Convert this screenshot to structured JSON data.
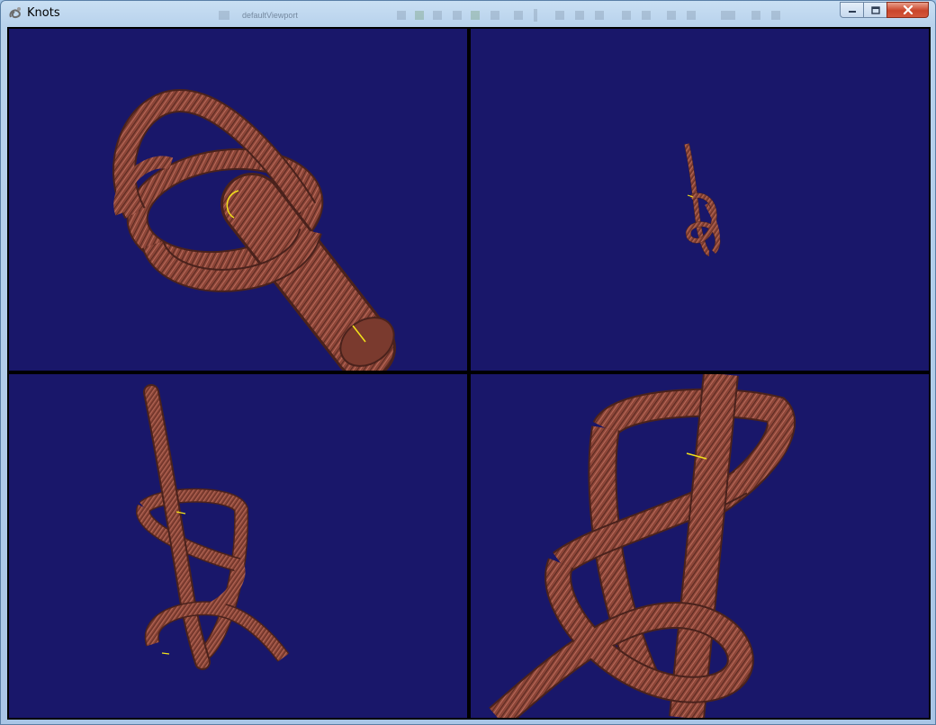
{
  "window": {
    "title": "Knots",
    "ghost_caption": "defaultViewport"
  },
  "colors": {
    "viewport_background": "#19176a",
    "tube_body": "#8c4537",
    "tube_highlight": "#c07262",
    "tube_shadow": "#5a2a22",
    "marker": "#f2e21a",
    "divider": "#000000"
  },
  "icons": {
    "app": "rope-icon",
    "minimize": "minimize-icon",
    "maximize": "maximize-icon",
    "close": "close-icon"
  },
  "viewports": [
    {
      "name": "viewport-top-left"
    },
    {
      "name": "viewport-top-right"
    },
    {
      "name": "viewport-bottom-left"
    },
    {
      "name": "viewport-bottom-right"
    }
  ]
}
